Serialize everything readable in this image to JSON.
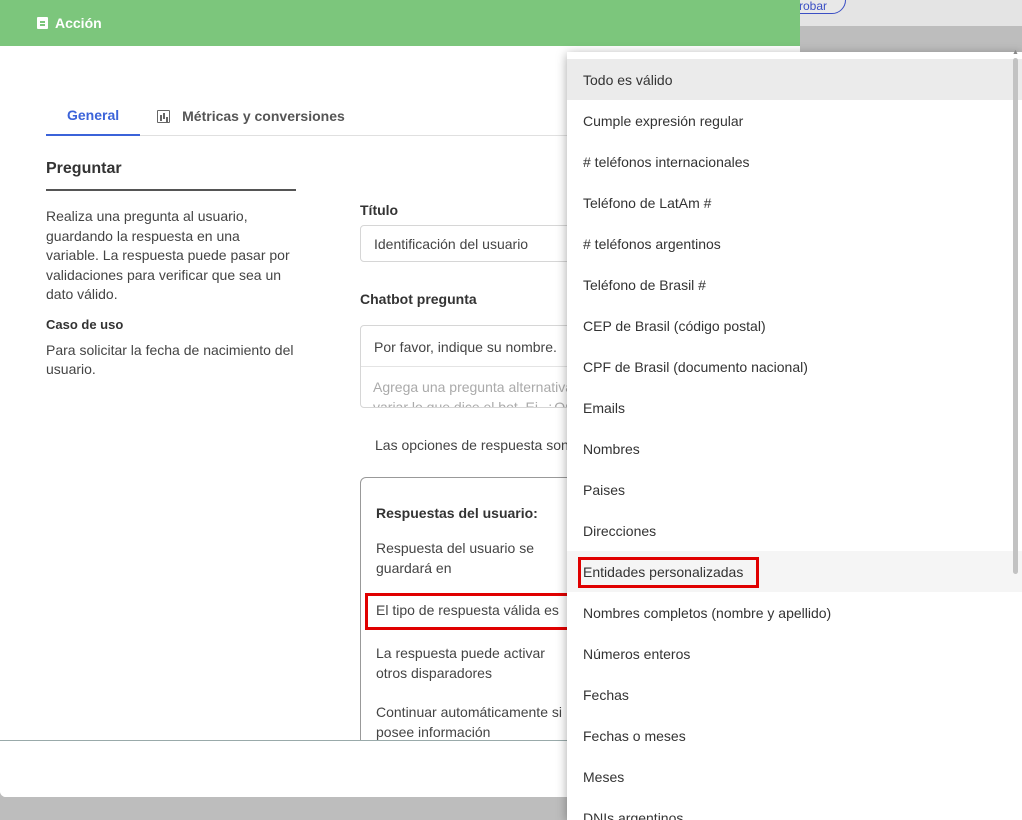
{
  "background": {
    "pill_text": "robar"
  },
  "modal": {
    "header_title": "Acción",
    "tabs": [
      {
        "label": "General",
        "active": true
      },
      {
        "label": "Métricas y conversiones",
        "active": false
      }
    ],
    "left": {
      "title": "Preguntar",
      "description": "Realiza una pregunta al usuario, guardando la respuesta en una variable. La respuesta puede pasar por validaciones para verificar que sea un dato válido.",
      "use_case_title": "Caso de uso",
      "use_case_text": "Para solicitar la fecha de nacimiento del usuario."
    },
    "form": {
      "title_label": "Título",
      "title_value": "Identificación del usuario",
      "question_label": "Chatbot pregunta",
      "question_value": "Por favor, indique su nombre.",
      "alt_placeholder_line1": "Agrega una pregunta alternativa",
      "alt_placeholder_line2": "variar lo que dice el bot. Ej. ¿Qu",
      "options_text": "Las opciones de respuesta son",
      "card": {
        "title": "Respuestas del usuario:",
        "line1": "Respuesta del usuario se guardará en",
        "line2": "El tipo de respuesta válida es",
        "line3": "La respuesta puede activar otros disparadores",
        "line4": "Continuar automáticamente si posee información"
      }
    }
  },
  "dropdown": {
    "selected": "Todo es válido",
    "highlighted": "Entidades personalizadas",
    "items": [
      "Todo es válido",
      "Cumple expresión regular",
      "# teléfonos internacionales",
      "Teléfono de LatAm #",
      "# teléfonos argentinos",
      "Teléfono de Brasil #",
      "CEP de Brasil (código postal)",
      "CPF de Brasil (documento nacional)",
      "Emails",
      "Nombres",
      "Paises",
      "Direcciones",
      "Entidades personalizadas",
      "Nombres completos (nombre y apellido)",
      "Números enteros",
      "Fechas",
      "Fechas o meses",
      "Meses",
      "DNIs argentinos"
    ]
  },
  "colors": {
    "header_green": "#7cc67c",
    "accent_blue": "#3b63d9",
    "highlight_red": "#e00000"
  }
}
